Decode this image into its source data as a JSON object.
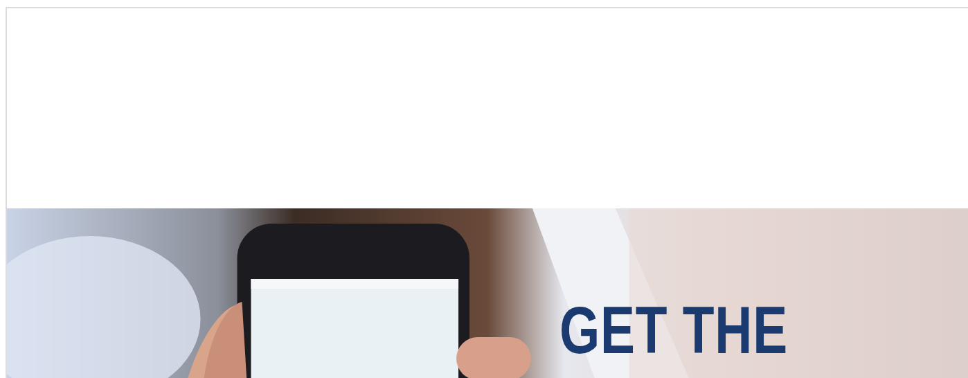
{
  "banner": {
    "kind": "picture",
    "headline": "GET THE"
  }
}
